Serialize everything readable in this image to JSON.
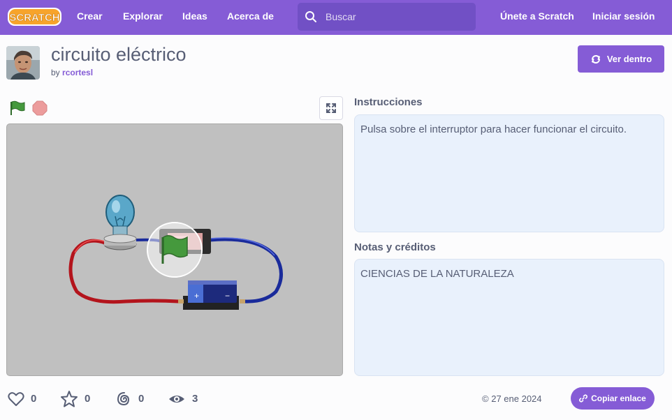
{
  "nav": {
    "logo_text": "SCRATCH",
    "links": [
      "Crear",
      "Explorar",
      "Ideas",
      "Acerca de"
    ],
    "search_placeholder": "Buscar",
    "join": "Únete a Scratch",
    "signin": "Iniciar sesión"
  },
  "project": {
    "title": "circuito eléctrico",
    "by": "by",
    "author": "rcortesl",
    "see_inside": "Ver dentro"
  },
  "instructions": {
    "heading": "Instrucciones",
    "text": "Pulsa sobre el interruptor para hacer funcionar el circuito."
  },
  "notes": {
    "heading": "Notas y créditos",
    "text": "CIENCIAS DE LA NATURALEZA"
  },
  "stats": {
    "loves": "0",
    "favorites": "0",
    "remixes": "0",
    "views": "3"
  },
  "date": "27 ene 2024",
  "copy_link": "Copiar enlace",
  "battery_plus": "+",
  "battery_minus": "−",
  "colors": {
    "brand": "#855cd6",
    "search_bg": "#7150c5",
    "green_flag": "#45993d",
    "stop": "#ec9c9c",
    "panel_bg": "#e9f1fc"
  }
}
